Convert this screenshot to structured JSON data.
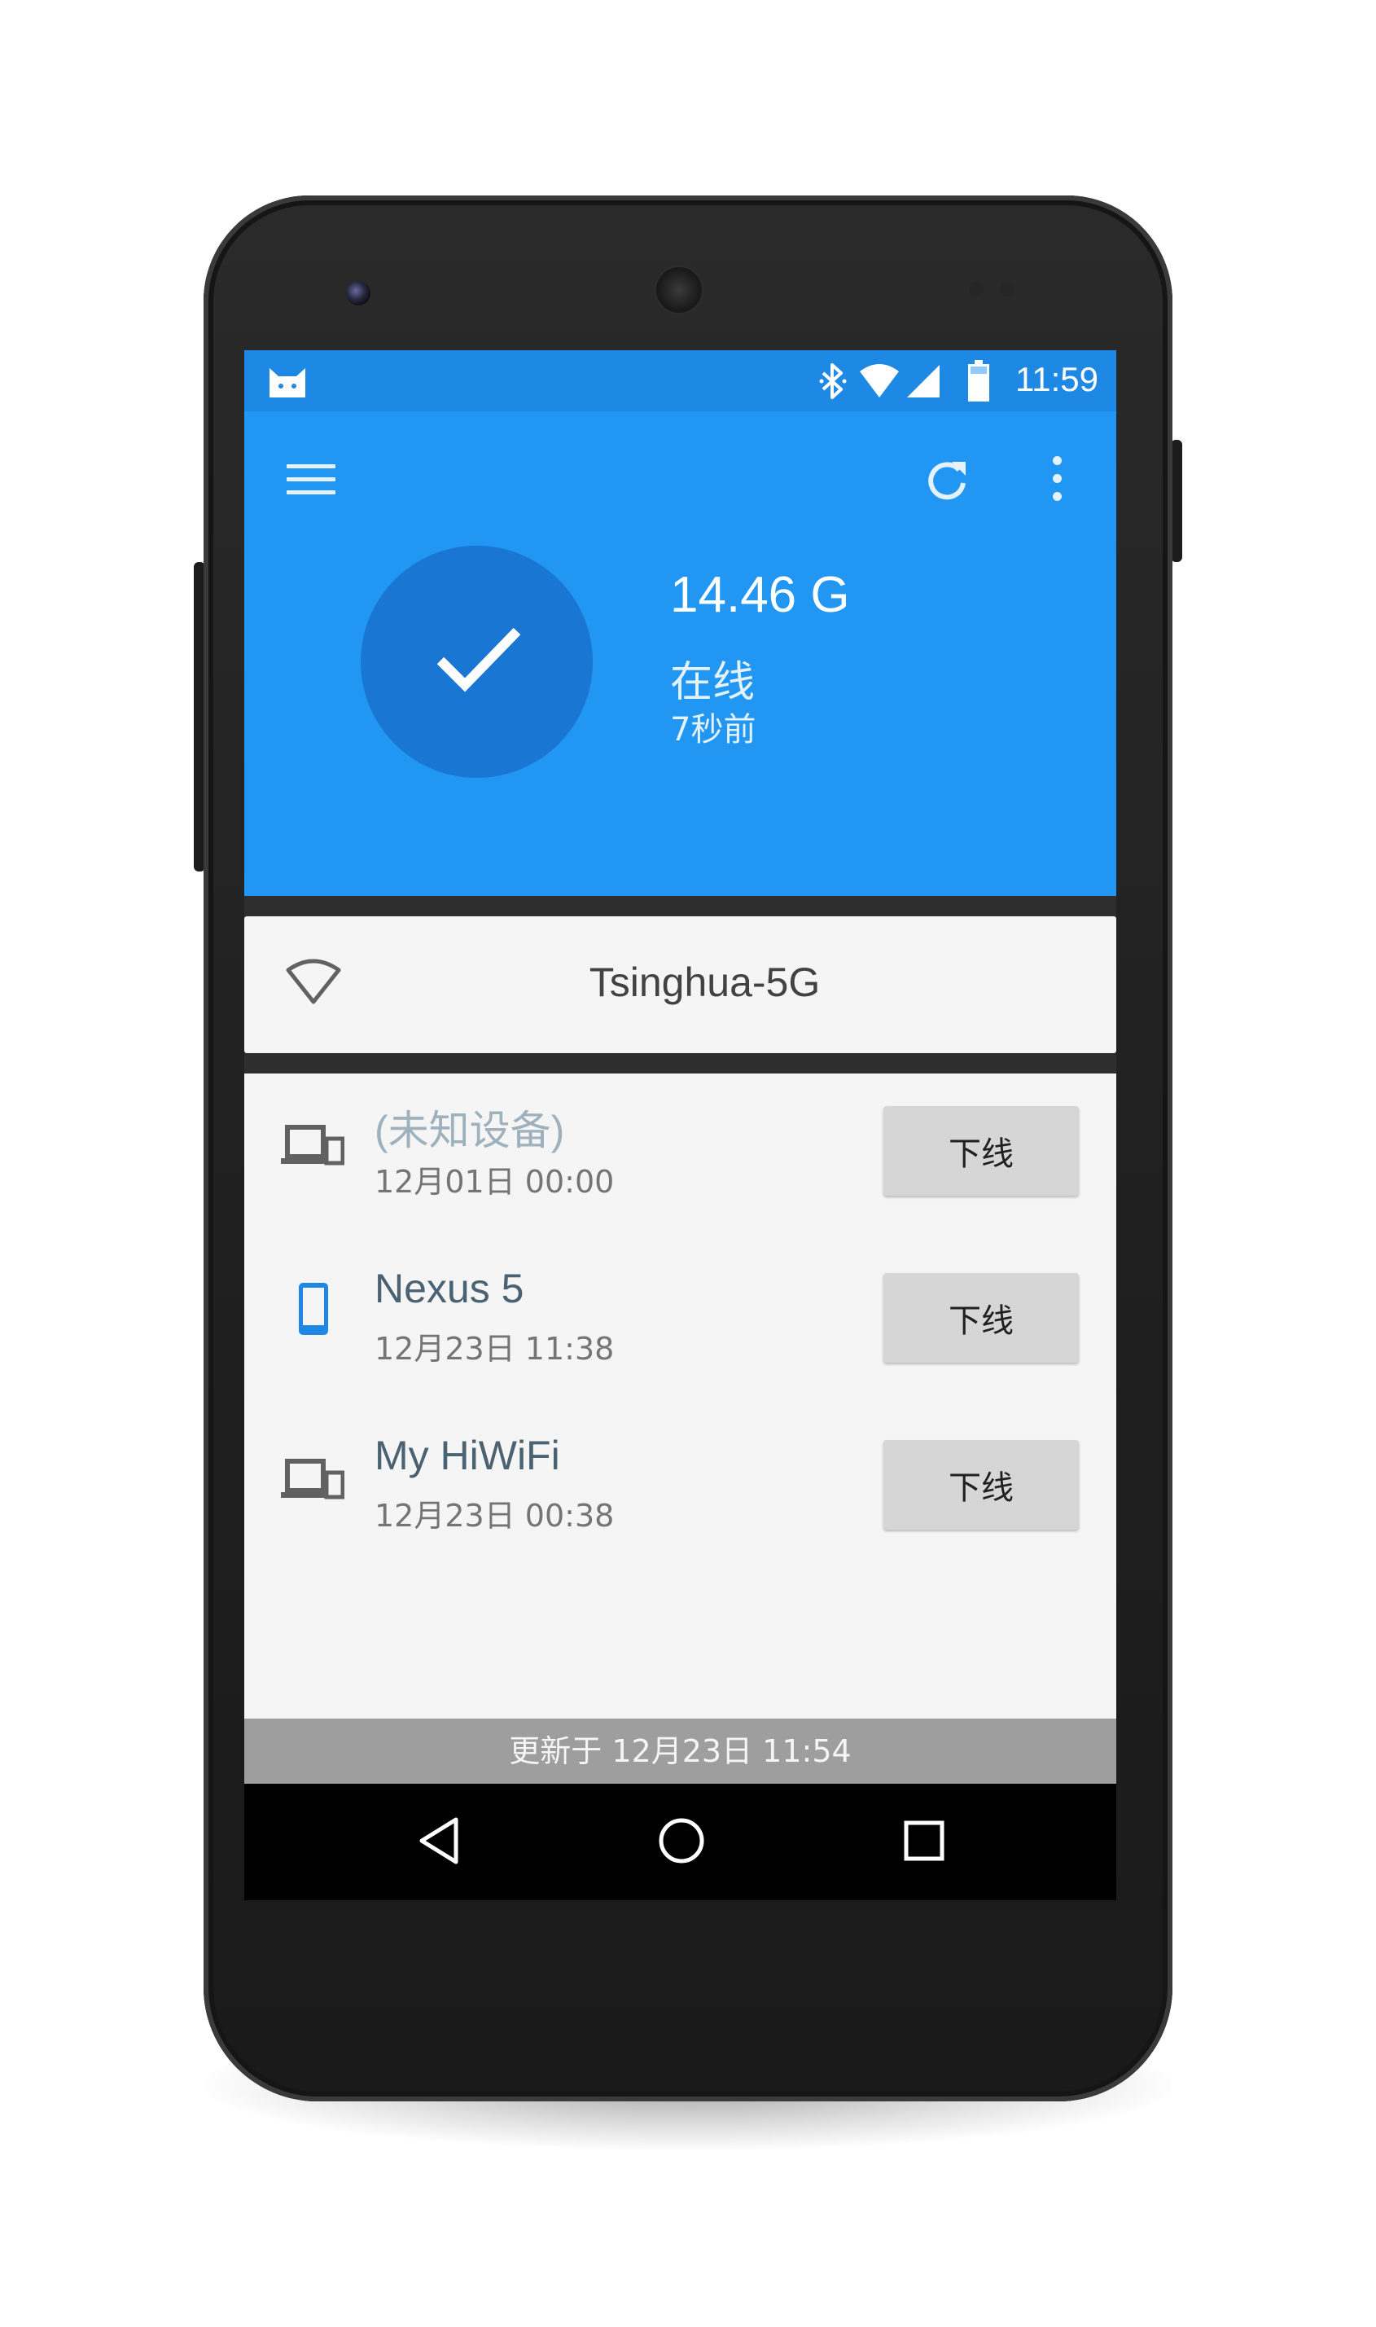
{
  "status_bar": {
    "time": "11:59"
  },
  "header": {
    "usage": "14.46 G",
    "state": "在线",
    "last_update_ago": "7秒前"
  },
  "network": {
    "ssid": "Tsinghua-5G"
  },
  "devices": [
    {
      "name": "(未知设备)",
      "time": "12月01日 00:00",
      "action": "下线",
      "icon": "devices-icon"
    },
    {
      "name": "Nexus 5",
      "time": "12月23日 11:38",
      "action": "下线",
      "icon": "smartphone-icon"
    },
    {
      "name": "My HiWiFi",
      "time": "12月23日 00:38",
      "action": "下线",
      "icon": "devices-icon"
    }
  ],
  "footer": {
    "updated": "更新于 12月23日 11:54"
  },
  "colors": {
    "primary": "#2196f3",
    "primary_dark": "#1976d2",
    "status_bar": "#1e88e5"
  }
}
